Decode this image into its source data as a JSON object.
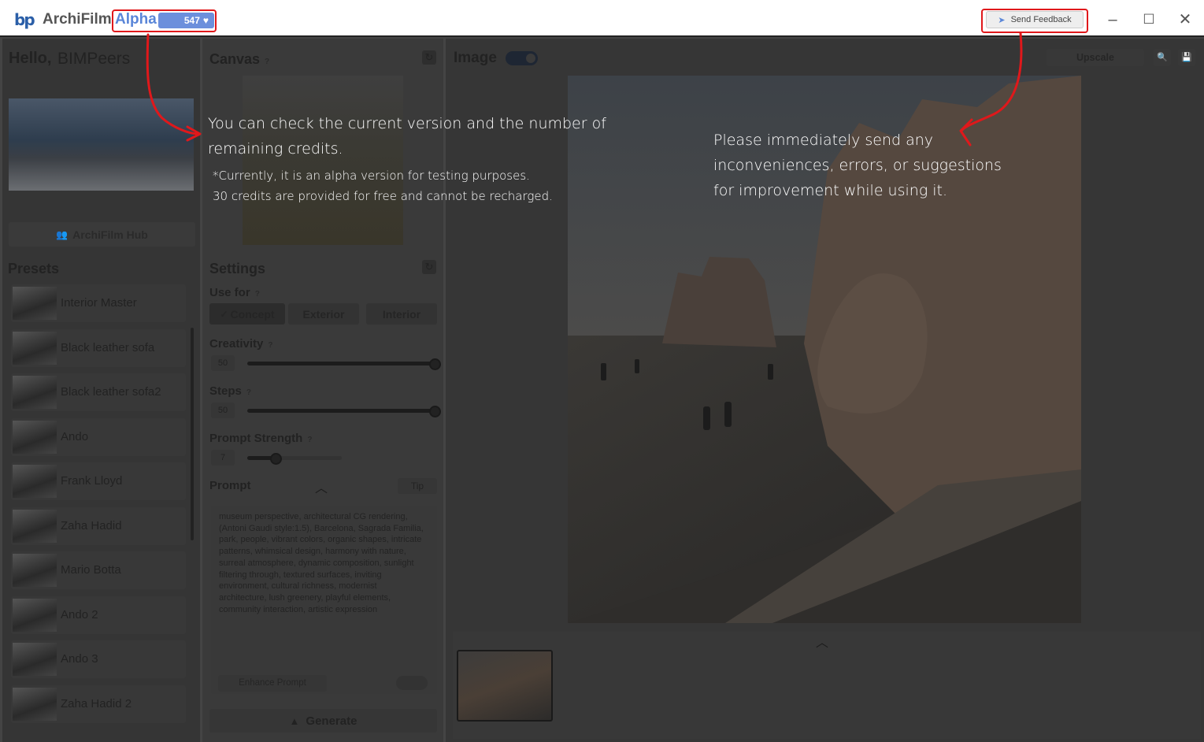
{
  "titlebar": {
    "app_name": "ArchiFilm",
    "version": "Alpha",
    "credits": "547",
    "feedback_label": "Send Feedback"
  },
  "sidebar": {
    "greeting": "Hello,",
    "user_name": "BIMPeers",
    "hub_label": "ArchiFilm Hub",
    "presets_title": "Presets",
    "presets": [
      {
        "label": "Interior Master"
      },
      {
        "label": "Black leather sofa"
      },
      {
        "label": "Black leather sofa2"
      },
      {
        "label": "Ando"
      },
      {
        "label": "Frank Lloyd"
      },
      {
        "label": "Zaha Hadid"
      },
      {
        "label": "Mario Botta"
      },
      {
        "label": "Ando 2"
      },
      {
        "label": "Ando 3"
      },
      {
        "label": "Zaha Hadid 2"
      }
    ]
  },
  "canvas": {
    "title": "Canvas",
    "help": "?"
  },
  "settings": {
    "title": "Settings",
    "use_for_label": "Use for",
    "use_for_options": [
      "Concept",
      "Exterior",
      "Interior"
    ],
    "use_for_selected": "Concept",
    "creativity_label": "Creativity",
    "creativity_value": "50",
    "creativity_fraction": 1.0,
    "steps_label": "Steps",
    "steps_value": "50",
    "steps_fraction": 1.0,
    "prompt_strength_label": "Prompt Strength",
    "prompt_strength_value": "7",
    "prompt_strength_fraction": 0.3,
    "prompt_label": "Prompt",
    "tip_label": "Tip",
    "prompt_text": "museum perspective, architectural CG rendering, (Antoni Gaudi style:1.5), Barcelona, Sagrada Familia, park, people, vibrant colors, organic shapes, intricate patterns, whimsical design, harmony with nature, surreal atmosphere, dynamic composition, sunlight filtering through, textured surfaces, inviting environment, cultural richness, modernist architecture, lush greenery, playful elements, community interaction, artistic expression",
    "enhance_label": "Enhance Prompt",
    "generate_label": "Generate"
  },
  "image_panel": {
    "title": "Image",
    "upscale_label": "Upscale"
  },
  "notes": {
    "left_line1": "You can check the current version and the number of",
    "left_line2": "remaining credits.",
    "left_small1": "*Currently, it is an alpha version for testing purposes.",
    "left_small2": "30 credits are provided for free and cannot be recharged.",
    "right_line1": "Please immediately send any",
    "right_line2": "inconveniences, errors, or suggestions",
    "right_line3": "for improvement while using it."
  },
  "colors": {
    "accent": "#6c8fdc",
    "annotation": "#e0181b"
  }
}
